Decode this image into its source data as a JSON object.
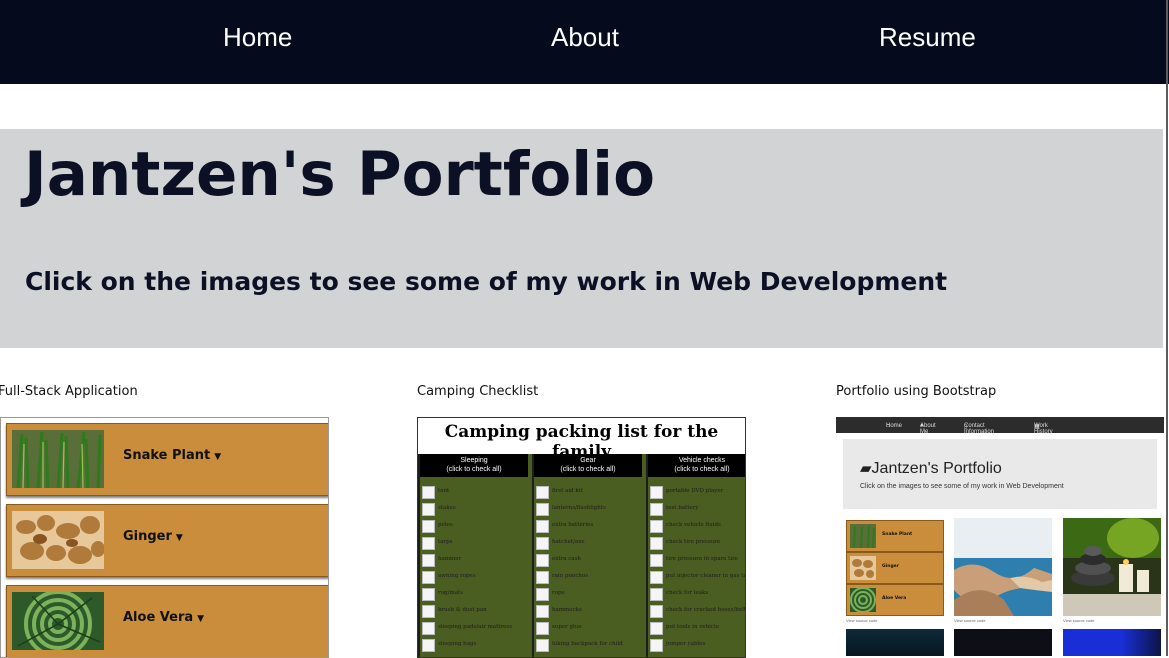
{
  "nav": {
    "home": "Home",
    "about": "About",
    "resume": "Resume"
  },
  "hero": {
    "title": "Jantzen's Portfolio",
    "subtitle": "Click on the images to see some of my work in Web Development"
  },
  "projects": [
    {
      "label": "Full-Stack Application",
      "preview": {
        "plants": [
          "Snake Plant",
          "Ginger",
          "Aloe Vera"
        ]
      }
    },
    {
      "label": "Camping Checklist",
      "preview": {
        "title": "Camping packing list for the family",
        "columns": [
          {
            "header": "Sleeping",
            "sub": "(click to check all)",
            "items": [
              "tent",
              "stakes",
              "poles",
              "tarps",
              "hammer",
              "awning ropes",
              "rug/mats",
              "brush & dust pan",
              "sleeping pads/air mattress",
              "sleeping bags"
            ]
          },
          {
            "header": "Gear",
            "sub": "(click to check all)",
            "items": [
              "first aid kit",
              "lanterns/flashlights",
              "extra batteries",
              "hatchet/axe",
              "extra cash",
              "rain ponchos",
              "rope",
              "hammocks",
              "super glue",
              "hiking backpack for child"
            ]
          },
          {
            "header": "Vehicle checks",
            "sub": "(click to check all)",
            "items": [
              "portable DVD player",
              "test battery",
              "check vehicle fluids",
              "check tire pressure",
              "tire pressure in spare tire",
              "put injector cleaner in gas tank",
              "check for leaks",
              "check for cracked hoses/belts",
              "put tools in vehicle",
              "jumper cables"
            ]
          }
        ]
      }
    },
    {
      "label": "Portfolio using Bootstrap",
      "preview": {
        "nav": [
          "Home",
          "About Me",
          "Contact Information",
          "Work History"
        ],
        "title": "Jantzen's Portfolio",
        "subtitle": "Click on the images to see some of my work in Web Development",
        "plants": [
          "Snake Plant",
          "Ginger",
          "Aloe Vera"
        ],
        "caption": "View source code"
      }
    }
  ],
  "colors": {
    "nav_bg": "#050b1c",
    "hero_bg": "#d1d3d5",
    "plant_card": "#c98d3c",
    "checklist_green": "#4b5e22"
  }
}
